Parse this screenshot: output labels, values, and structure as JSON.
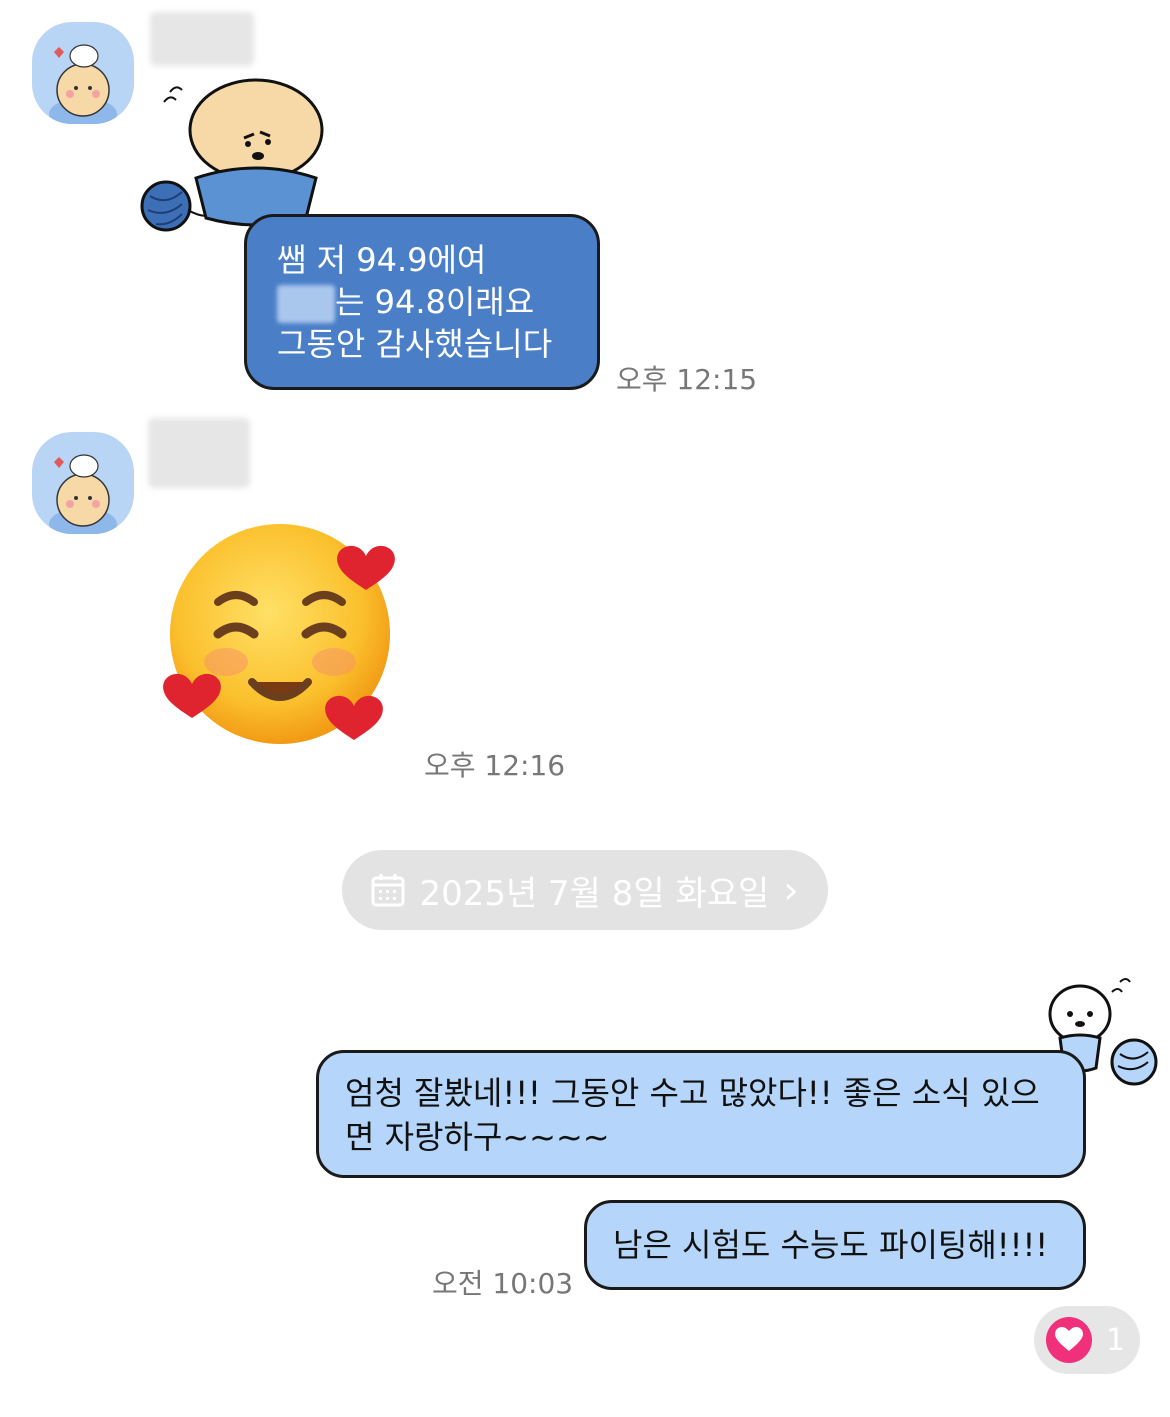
{
  "messages": [
    {
      "lines": [
        "쌤 저 94.9에여",
        "는 94.8이래요",
        "그동안 감사했습니다"
      ],
      "time": "오후 12:15"
    },
    {
      "time": "오후 12:16",
      "emoji": "smiling-face-with-hearts"
    }
  ],
  "date_separator": {
    "label": "2025년 7월 8일 화요일",
    "icon": "calendar-icon",
    "chevron": "›"
  },
  "outgoing": [
    {
      "lines": [
        "엄청 잘봤네!!! 그동안 수고 많았다!! 좋은 소식 있으",
        "면 자랑하구~~~~"
      ]
    },
    {
      "lines": [
        "남은 시험도 수능도 파이팅해!!!!"
      ],
      "time": "오전 10:03"
    }
  ],
  "reaction": {
    "icon": "heart-icon",
    "count": "1"
  },
  "colors": {
    "incoming_bubble": "#4a7fc8",
    "outgoing_bubble": "#b5d6fa",
    "avatar_bg": "#b8d5f5",
    "reaction_heart": "#f0307a"
  }
}
